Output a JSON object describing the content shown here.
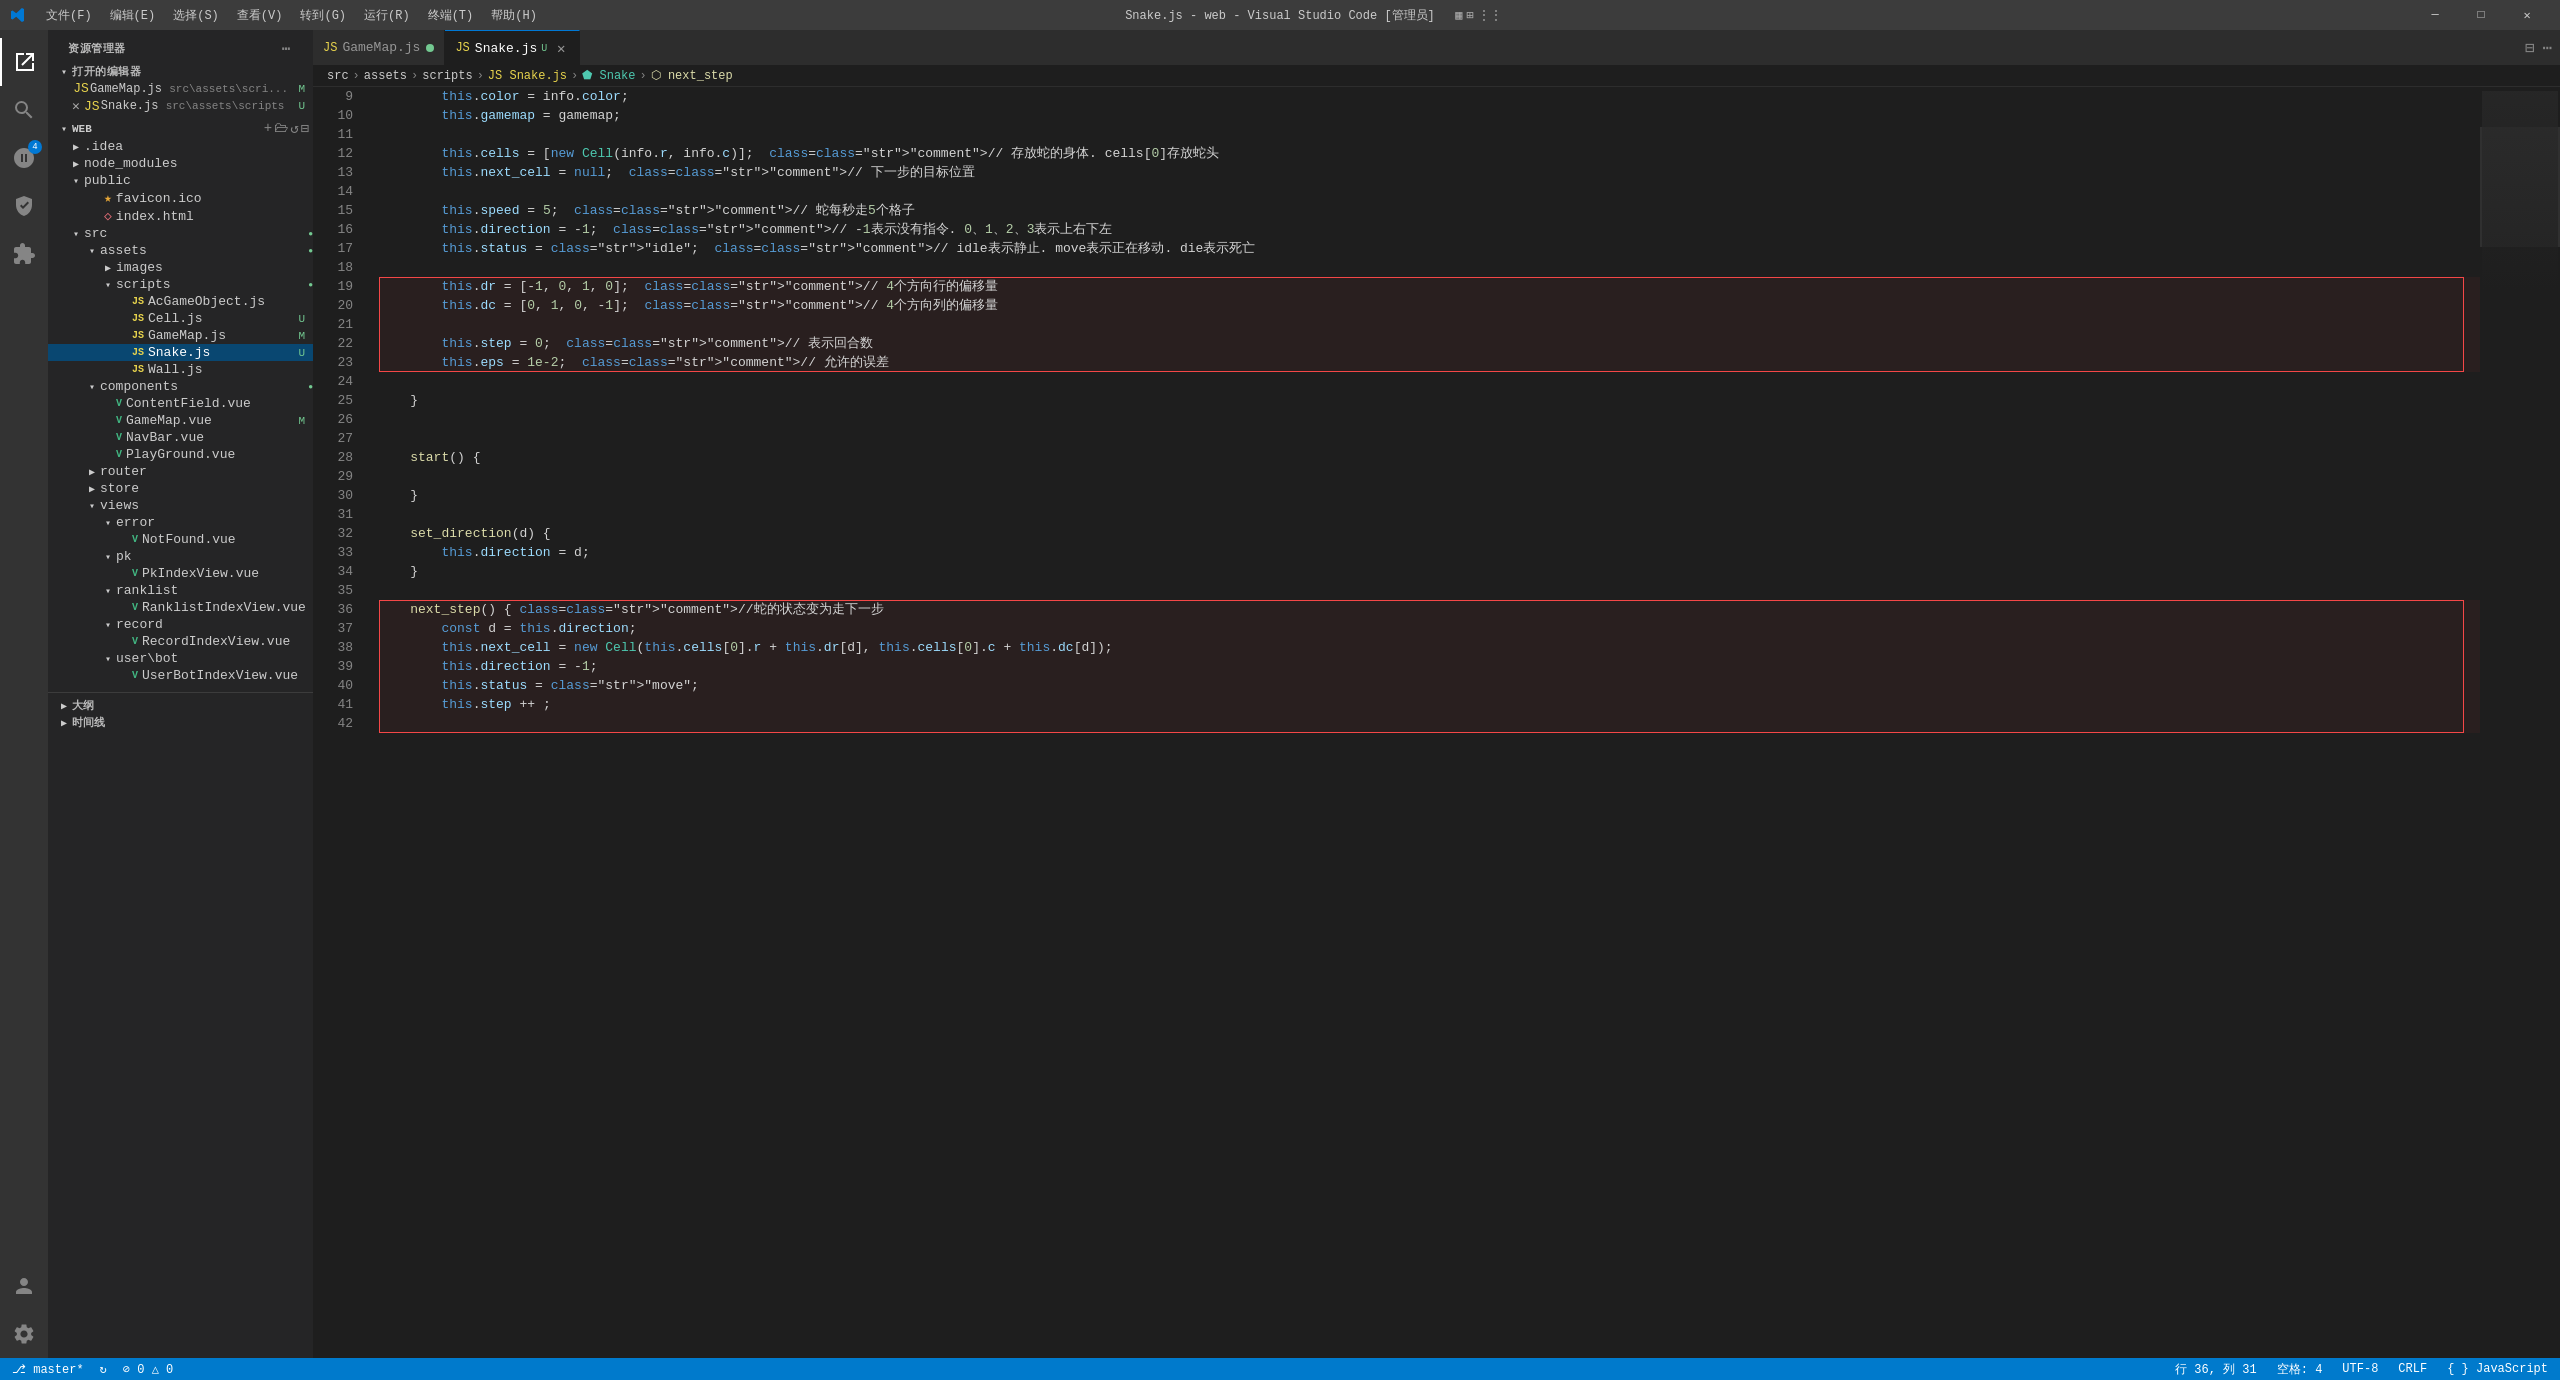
{
  "titlebar": {
    "title": "Snake.js - web - Visual Studio Code [管理员]",
    "menus": [
      "文件(F)",
      "编辑(E)",
      "选择(S)",
      "查看(V)",
      "转到(G)",
      "运行(R)",
      "终端(T)",
      "帮助(H)"
    ],
    "controls": [
      "─",
      "□",
      "✕"
    ]
  },
  "sidebar": {
    "header": "资源管理器",
    "section_open": "打开的编辑器",
    "open_editors": [
      {
        "name": "GameMap.js",
        "path": "src\\assets\\scri...",
        "badge": "M",
        "icon": "js"
      },
      {
        "name": "Snake.js",
        "path": "src\\assets\\scripts",
        "badge": "U",
        "icon": "js",
        "active": true
      }
    ],
    "root": "WEB",
    "tree": [
      {
        "level": 0,
        "type": "folder",
        "name": ".idea",
        "open": false
      },
      {
        "level": 0,
        "type": "folder",
        "name": "node_modules",
        "open": false
      },
      {
        "level": 0,
        "type": "folder",
        "name": "public",
        "open": true
      },
      {
        "level": 1,
        "type": "file",
        "name": "favicon.ico",
        "icon": "ico"
      },
      {
        "level": 1,
        "type": "file",
        "name": "index.html",
        "icon": "html"
      },
      {
        "level": 0,
        "type": "folder",
        "name": "src",
        "open": true,
        "dot": true
      },
      {
        "level": 1,
        "type": "folder",
        "name": "assets",
        "open": true,
        "dot": true
      },
      {
        "level": 2,
        "type": "folder",
        "name": "images",
        "open": false
      },
      {
        "level": 2,
        "type": "folder",
        "name": "scripts",
        "open": true,
        "dot": true
      },
      {
        "level": 3,
        "type": "file",
        "name": "AcGameObject.js",
        "icon": "js"
      },
      {
        "level": 3,
        "type": "file",
        "name": "Cell.js",
        "icon": "js",
        "badge": "U"
      },
      {
        "level": 3,
        "type": "file",
        "name": "GameMap.js",
        "icon": "js",
        "badge": "M"
      },
      {
        "level": 3,
        "type": "file",
        "name": "Snake.js",
        "icon": "js",
        "badge": "U",
        "active": true
      },
      {
        "level": 3,
        "type": "file",
        "name": "Wall.js",
        "icon": "js"
      },
      {
        "level": 1,
        "type": "folder",
        "name": "components",
        "open": true,
        "dot": true
      },
      {
        "level": 2,
        "type": "file",
        "name": "ContentField.vue",
        "icon": "vue"
      },
      {
        "level": 2,
        "type": "file",
        "name": "GameMap.vue",
        "icon": "vue",
        "badge": "M"
      },
      {
        "level": 2,
        "type": "file",
        "name": "NavBar.vue",
        "icon": "vue"
      },
      {
        "level": 2,
        "type": "file",
        "name": "PlayGround.vue",
        "icon": "vue"
      },
      {
        "level": 1,
        "type": "folder",
        "name": "router",
        "open": false
      },
      {
        "level": 1,
        "type": "folder",
        "name": "store",
        "open": false
      },
      {
        "level": 1,
        "type": "folder",
        "name": "views",
        "open": true
      },
      {
        "level": 2,
        "type": "folder",
        "name": "error",
        "open": true
      },
      {
        "level": 3,
        "type": "file",
        "name": "NotFound.vue",
        "icon": "vue"
      },
      {
        "level": 2,
        "type": "folder",
        "name": "pk",
        "open": true
      },
      {
        "level": 3,
        "type": "file",
        "name": "PkIndexView.vue",
        "icon": "vue"
      },
      {
        "level": 2,
        "type": "folder",
        "name": "ranklist",
        "open": true
      },
      {
        "level": 3,
        "type": "file",
        "name": "RanklistIndexView.vue",
        "icon": "vue"
      },
      {
        "level": 2,
        "type": "folder",
        "name": "record",
        "open": true
      },
      {
        "level": 3,
        "type": "file",
        "name": "RecordIndexView.vue",
        "icon": "vue"
      },
      {
        "level": 2,
        "type": "folder",
        "name": "user\\bot",
        "open": true
      },
      {
        "level": 3,
        "type": "file",
        "name": "UserBotIndexView.vue",
        "icon": "vue"
      }
    ],
    "bottom": [
      {
        "name": "大纲"
      },
      {
        "name": "时间线"
      }
    ]
  },
  "tabs": [
    {
      "name": "GameMap.js",
      "badge": "M",
      "active": false
    },
    {
      "name": "Snake.js",
      "badge": "U",
      "active": true,
      "closable": true
    }
  ],
  "breadcrumb": [
    "src",
    ">",
    "assets",
    ">",
    "scripts",
    ">",
    "JS Snake.js",
    ">",
    "Snake",
    ">",
    "next_step"
  ],
  "code": {
    "lines": [
      {
        "num": 9,
        "text": "        this.color = info.color;"
      },
      {
        "num": 10,
        "text": "        this.gamemap = gamemap;"
      },
      {
        "num": 11,
        "text": ""
      },
      {
        "num": 12,
        "text": "        this.cells = [new Cell(info.r, info.c)];  // 存放蛇的身体. cells[0]存放蛇头"
      },
      {
        "num": 13,
        "text": "        this.next_cell = null;  // 下一步的目标位置"
      },
      {
        "num": 14,
        "text": ""
      },
      {
        "num": 15,
        "text": "        this.speed = 5;  // 蛇每秒走5个格子"
      },
      {
        "num": 16,
        "text": "        this.direction = -1;  // -1表示没有指令. 0、1、2、3表示上右下左"
      },
      {
        "num": 17,
        "text": "        this.status = \"idle\";  // idle表示静止. move表示正在移动. die表示死亡"
      },
      {
        "num": 18,
        "text": ""
      },
      {
        "num": 19,
        "text": "        this.dr = [-1, 0, 1, 0];  // 4个方向行的偏移量",
        "box_start": true
      },
      {
        "num": 20,
        "text": "        this.dc = [0, 1, 0, -1];  // 4个方向列的偏移量"
      },
      {
        "num": 21,
        "text": ""
      },
      {
        "num": 22,
        "text": "        this.step = 0;  // 表示回合数"
      },
      {
        "num": 23,
        "text": "        this.eps = 1e-2;  // 允许的误差",
        "box_end": true
      },
      {
        "num": 24,
        "text": ""
      },
      {
        "num": 25,
        "text": "    }"
      },
      {
        "num": 26,
        "text": ""
      },
      {
        "num": 27,
        "text": ""
      },
      {
        "num": 28,
        "text": "    start() {"
      },
      {
        "num": 29,
        "text": ""
      },
      {
        "num": 30,
        "text": "    }"
      },
      {
        "num": 31,
        "text": ""
      },
      {
        "num": 32,
        "text": "    set_direction(d) {"
      },
      {
        "num": 33,
        "text": "        this.direction = d;"
      },
      {
        "num": 34,
        "text": "    }"
      },
      {
        "num": 35,
        "text": ""
      },
      {
        "num": 36,
        "text": "    next_step() { //蛇的状态变为走下一步",
        "box2_start": true
      },
      {
        "num": 37,
        "text": "        const d = this.direction;"
      },
      {
        "num": 38,
        "text": "        this.next_cell = new Cell(this.cells[0].r + this.dr[d], this.cells[0].c + this.dc[d]);"
      },
      {
        "num": 39,
        "text": "        this.direction = -1;"
      },
      {
        "num": 40,
        "text": "        this.status = \"move\";"
      },
      {
        "num": 41,
        "text": "        this.step ++ ;"
      },
      {
        "num": 42,
        "text": ""
      }
    ]
  },
  "status_bar": {
    "left": [
      "⎇ master*",
      "↻",
      "⊘ 0 △ 0"
    ],
    "right": [
      "行 36, 列 31",
      "空格: 4",
      "UTF-8",
      "CRLF",
      "{ } JavaScript"
    ]
  }
}
